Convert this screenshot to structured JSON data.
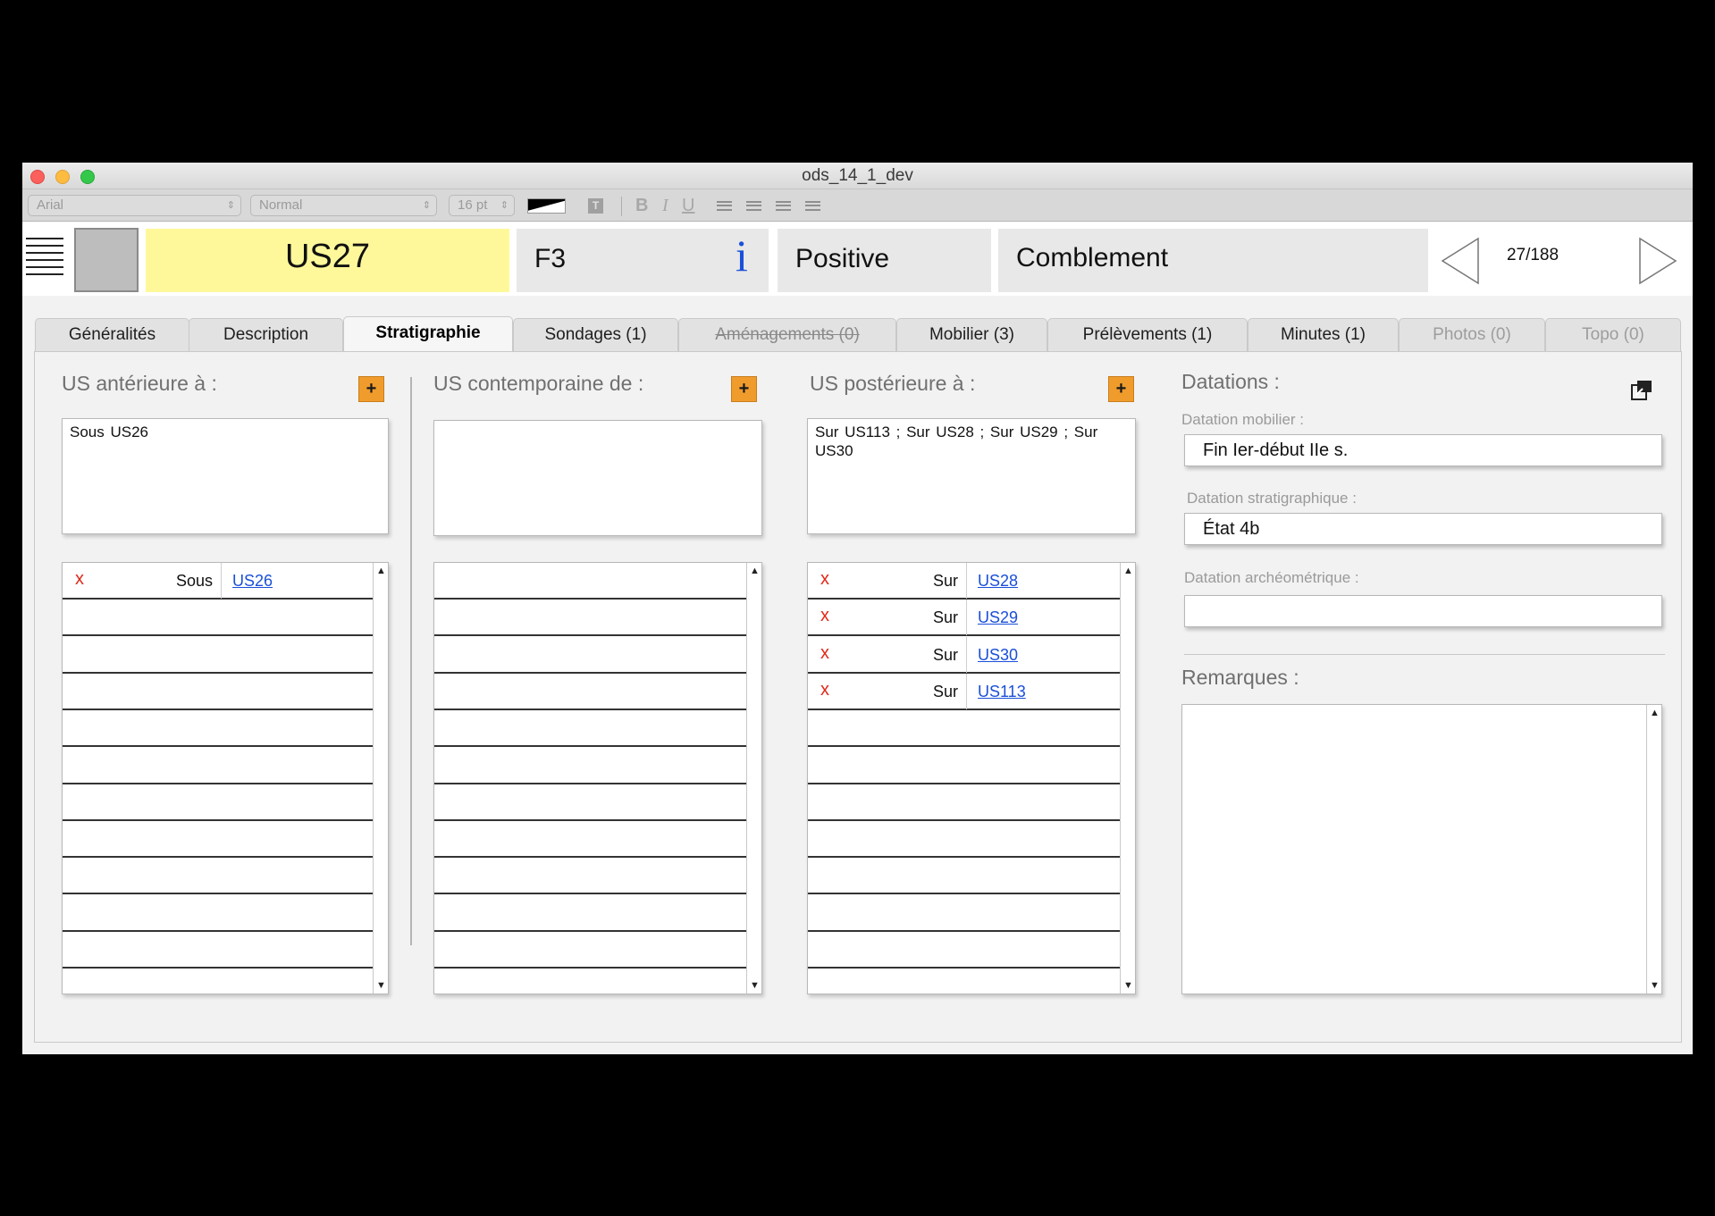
{
  "window": {
    "title": "ods_14_1_dev"
  },
  "format_bar": {
    "font": "Arial",
    "style": "Normal",
    "size": "16 pt",
    "bold": "B",
    "italic": "I",
    "underline": "U"
  },
  "header": {
    "us_id": "US27",
    "feature": "F3",
    "info_glyph": "i",
    "type": "Positive",
    "nature": "Comblement",
    "record_counter": "27/188",
    "us_box_color": "#fff89a"
  },
  "tabs": [
    {
      "label": "Généralités",
      "state": "normal"
    },
    {
      "label": "Description",
      "state": "normal"
    },
    {
      "label": "Stratigraphie",
      "state": "active"
    },
    {
      "label": "Sondages (1)",
      "state": "normal"
    },
    {
      "label": "Aménagements (0)",
      "state": "strike"
    },
    {
      "label": "Mobilier (3)",
      "state": "normal"
    },
    {
      "label": "Prélèvements (1)",
      "state": "normal"
    },
    {
      "label": "Minutes (1)",
      "state": "normal"
    },
    {
      "label": "Photos (0)",
      "state": "disabled"
    },
    {
      "label": "Topo (0)",
      "state": "disabled"
    }
  ],
  "sections": {
    "anterieure": {
      "title": "US antérieure à :",
      "summary": "Sous US26",
      "rows": [
        {
          "delete": "x",
          "relation": "Sous",
          "link": "US26"
        }
      ]
    },
    "contemporaine": {
      "title": "US contemporaine de :",
      "summary": "",
      "rows": []
    },
    "posterieure": {
      "title": "US postérieure à :",
      "summary": "Sur US113 ; Sur US28 ; Sur US29 ; Sur US30",
      "rows": [
        {
          "delete": "x",
          "relation": "Sur",
          "link": "US28"
        },
        {
          "delete": "x",
          "relation": "Sur",
          "link": "US29"
        },
        {
          "delete": "x",
          "relation": "Sur",
          "link": "US30"
        },
        {
          "delete": "x",
          "relation": "Sur",
          "link": "US113"
        }
      ]
    }
  },
  "add_button_label": "+",
  "datations": {
    "title": "Datations :",
    "mobilier": {
      "label": "Datation mobilier :",
      "value": "Fin Ier-début IIe s."
    },
    "stratigraphique": {
      "label": "Datation stratigraphique :",
      "value": "État 4b"
    },
    "archeometrique": {
      "label": "Datation archéométrique :",
      "value": ""
    }
  },
  "remarques": {
    "title": "Remarques :",
    "value": ""
  },
  "colors": {
    "accent_add": "#f09c2c",
    "delete": "#e02a1a",
    "link": "#1a4fd8"
  }
}
